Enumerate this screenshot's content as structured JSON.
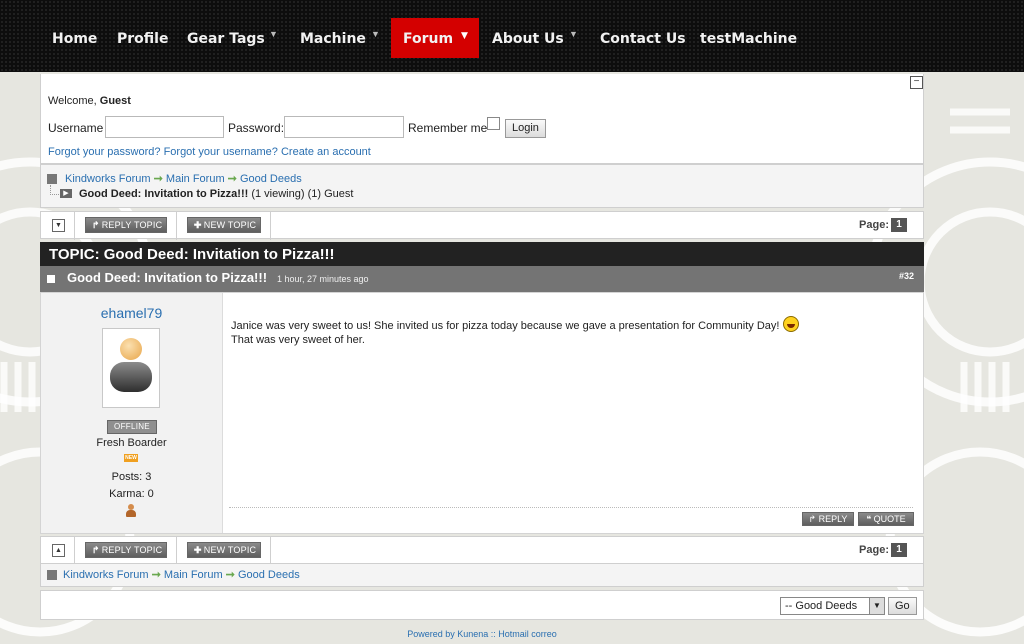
{
  "nav": {
    "items": [
      {
        "label": "Home"
      },
      {
        "label": "Profile"
      },
      {
        "label": "Gear Tags"
      },
      {
        "label": "Machine"
      },
      {
        "label": "Forum"
      },
      {
        "label": "About Us"
      },
      {
        "label": "Contact Us"
      },
      {
        "label": "testMachine"
      }
    ],
    "active": "Forum",
    "active_color": "#d40000"
  },
  "login": {
    "welcome_prefix": "Welcome,",
    "welcome_user": "Guest",
    "username_label": "Username",
    "username_value": "",
    "password_label": "Password:",
    "password_value": "",
    "remember_label": "Remember me",
    "remember_checked": false,
    "login_button": "Login",
    "links": {
      "forgot_password": "Forgot your password?",
      "forgot_username": "Forgot your username?",
      "create_account": "Create an account"
    }
  },
  "breadcrumb": {
    "items": [
      "Kindworks Forum",
      "Main Forum",
      "Good Deeds"
    ],
    "current_topic": "Good Deed: Invitation to Pizza!!!",
    "viewing": "(1 viewing) (1) Guest"
  },
  "toolbar": {
    "reply_topic": "REPLY TOPIC",
    "new_topic": "NEW TOPIC",
    "page_label": "Page:",
    "page_number": "1"
  },
  "topic": {
    "title": "TOPIC: Good Deed: Invitation to Pizza!!!"
  },
  "post": {
    "subject": "Good Deed: Invitation to Pizza!!!",
    "time": "1 hour, 27 minutes ago",
    "number": "#32",
    "author": {
      "name": "ehamel79",
      "status": "OFFLINE",
      "rank": "Fresh Boarder",
      "new_badge": "NEW",
      "posts": "Posts: 3",
      "karma": "Karma: 0"
    },
    "body_line1": "Janice was very sweet to us! She invited us for pizza today because we gave a presentation for Community Day!",
    "body_line2": "That was very sweet of her.",
    "reply_button": "REPLY",
    "quote_button": "QUOTE"
  },
  "footer": {
    "jump_select": "-- Good Deeds",
    "go_button": "Go",
    "powered_by": "Powered by Kunena :: Hotmail correo"
  },
  "icons": {
    "collapse": "minus-box-icon",
    "breadcrumb": "square-icon",
    "reply": "reply-arrow-icon",
    "new_topic": "plus-icon",
    "toggle_down": "chevron-down-icon",
    "toggle_up": "chevron-up-icon",
    "smiley": "laughing-smiley-icon",
    "gender": "user-figure-icon"
  }
}
